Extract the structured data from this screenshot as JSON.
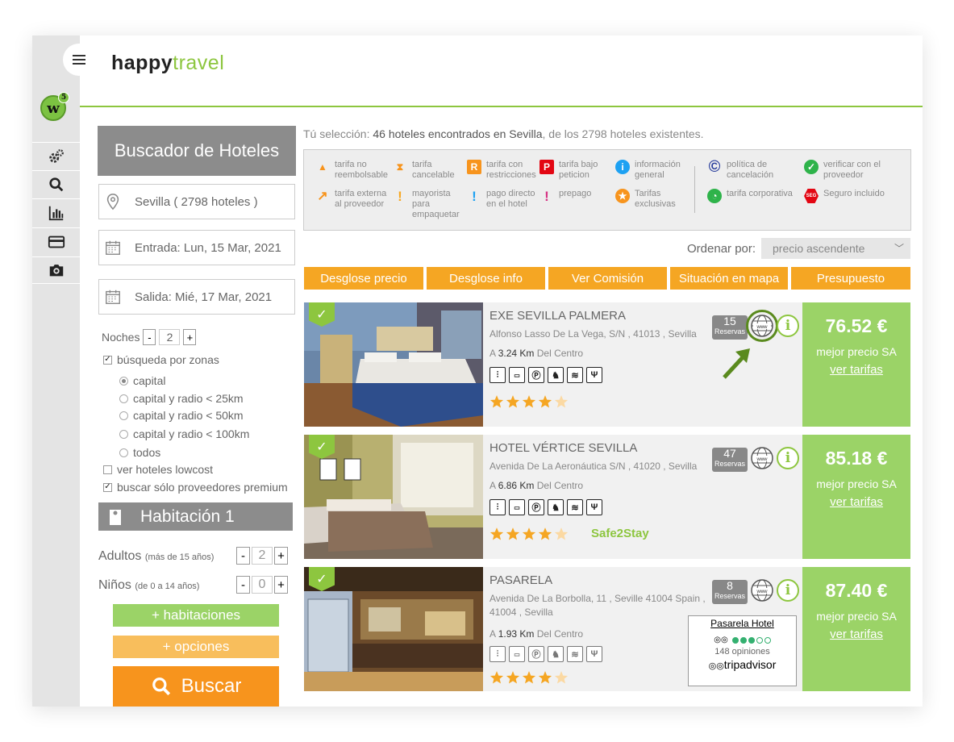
{
  "brand": {
    "part1": "happy",
    "part2": "travel"
  },
  "sidebar": {
    "badge_letter": "w",
    "badge_count": "5",
    "icons": [
      "settings-icon",
      "search-icon",
      "chart-icon",
      "card-icon",
      "camera-icon"
    ]
  },
  "search": {
    "title": "Buscador de Hoteles",
    "destination": "Sevilla ( 2798 hoteles )",
    "checkin": "Entrada: Lun, 15 Mar, 2021",
    "checkout": "Salida: Mié, 17 Mar, 2021",
    "nights_label": "Noches",
    "nights_minus": "-",
    "nights_value": "2",
    "nights_plus": "+",
    "zone_search": "búsqueda por zonas",
    "zones": [
      "capital",
      "capital y radio < 25km",
      "capital y radio < 50km",
      "capital y radio < 100km",
      "todos"
    ],
    "lowcost": "ver hoteles lowcost",
    "premium": "buscar sólo proveedores premium",
    "room_title": "Habitación 1",
    "adults_label": "Adultos",
    "adults_note": "(más de 15 años)",
    "adults_value": "2",
    "kids_label": "Niños",
    "kids_note": "(de 0 a 14 años)",
    "kids_value": "0",
    "add_rooms": "+ habitaciones",
    "options": "+ opciones",
    "search_button": "Buscar"
  },
  "results": {
    "selection_prefix": "Tú selección:",
    "selection_bold": "46 hoteles encontrados en Sevilla",
    "selection_suffix": ", de los 2798 hoteles existentes.",
    "legend": [
      "tarifa no reembolsable",
      "tarifa cancelable",
      "tarifa con restricciones",
      "tarifa bajo peticion",
      "información general",
      "tarifa externa al proveedor",
      "mayorista para empaquetar",
      "pago directo en el hotel",
      "prepago",
      "Tarifas exclusivas",
      "política de cancelación",
      "verificar con el proveedor",
      "tarifa corporativa",
      "Seguro incluido"
    ],
    "order_label": "Ordenar por:",
    "order_value": "precio ascendente",
    "tabs": [
      "Desglose precio",
      "Desglose info",
      "Ver Comisión",
      "Situación en mapa",
      "Presupuesto"
    ],
    "reservas_label": "Reservas",
    "km_prefix": "A",
    "km_suffix": "Del Centro",
    "best_price": "mejor precio SA",
    "see_rates": "ver tarifas",
    "hotels": [
      {
        "name": "EXE SEVILLA PALMERA",
        "address": "Alfonso Lasso De La Vega, S/N , 41013 , Sevilla",
        "km": "3.24 Km",
        "reservas": "15",
        "price": "76.52 €",
        "stars": 4,
        "extra": ""
      },
      {
        "name": "HOTEL VÉRTICE SEVILLA",
        "address": "Avenida De La Aeronáutica S/N , 41020 , Sevilla",
        "km": "6.86 Km",
        "reservas": "47",
        "price": "85.18 €",
        "stars": 4,
        "extra": "Safe2Stay"
      },
      {
        "name": "PASARELA",
        "address": "Avenida De La Borbolla, 11 , Seville 41004 Spain , 41004 , Sevilla",
        "km": "1.93 Km",
        "reservas": "8",
        "price": "87.40 €",
        "stars": 4,
        "extra": ""
      }
    ],
    "tripadvisor": {
      "hotel": "Pasarela Hotel",
      "rating": 3,
      "reviews": "148 opiniones",
      "brand": "tripadvisor"
    }
  },
  "colors": {
    "green": "#8dc63f",
    "orange": "#f5a623",
    "price_green": "#9bd367",
    "search_orange": "#f7941d"
  }
}
